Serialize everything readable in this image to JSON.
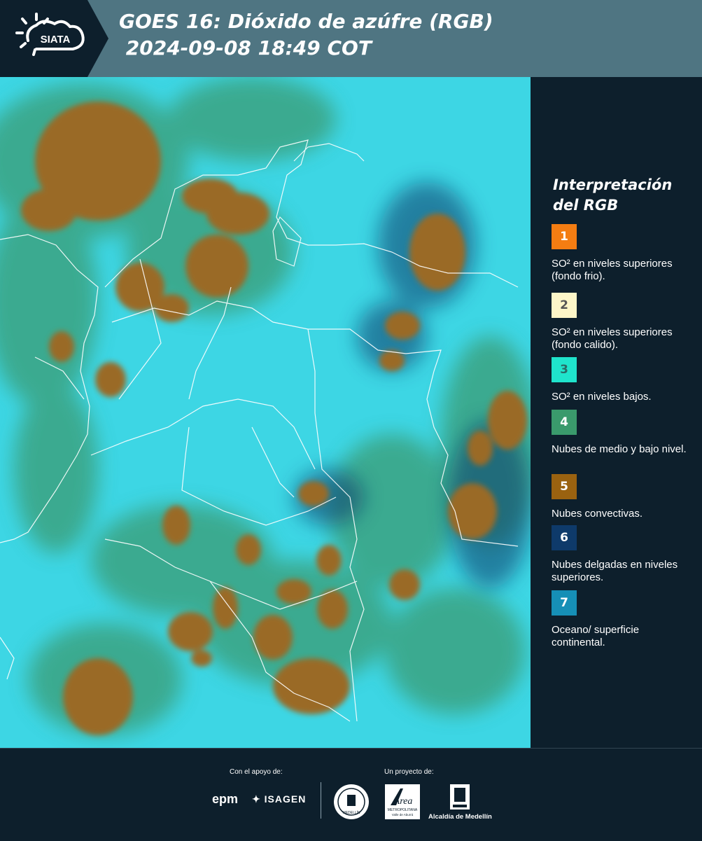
{
  "header": {
    "logo_text": "SIATA",
    "title_line1": "GOES 16: Dióxido de azúfre (RGB)",
    "title_line2": " 2024-09-08 18:49 COT"
  },
  "legend": {
    "title": "Interpretación del RGB",
    "items": [
      {
        "num": "1",
        "color": "#f47d12",
        "label": "SO² en niveles superiores (fondo frio)."
      },
      {
        "num": "2",
        "color": "#fdf6c8",
        "label": "SO² en niveles superiores (fondo calido)."
      },
      {
        "num": "3",
        "color": "#1fe4cc",
        "label": "SO² en niveles bajos."
      },
      {
        "num": "4",
        "color": "#3a9a6c",
        "label": "Nubes de medio y bajo nivel."
      },
      {
        "num": "5",
        "color": "#9a6210",
        "label": "Nubes convectivas."
      },
      {
        "num": "6",
        "color": "#0e3a6a",
        "label": "Nubes delgadas en niveles superiores."
      },
      {
        "num": "7",
        "color": "#168fb6",
        "label": "Oceano/ superficie continental."
      }
    ]
  },
  "footer": {
    "support_label": "Con el apoyo de:",
    "project_label": "Un proyecto de:",
    "logo_epm": "epm",
    "logo_isagen": "ISAGEN",
    "logo_medellin_seal": "MEDELLÍN",
    "logo_area_text": "Área",
    "logo_area_sub": "METROPOLITANA",
    "logo_area_sub2": "Valle de Aburrá",
    "logo_alcaldia": "Alcaldía de Medellín"
  }
}
